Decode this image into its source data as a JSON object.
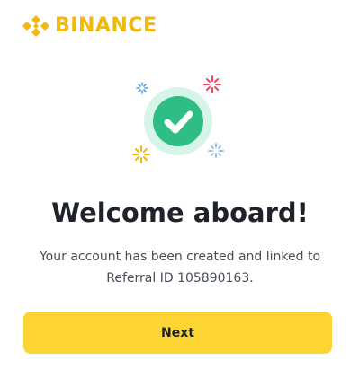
{
  "brand": {
    "name": "BINANCE",
    "logo_icon": "binance-diamond-icon",
    "color": "#F0B90B"
  },
  "illustration": {
    "icon": "check-circle-icon",
    "ring_color": "#D6F5E8",
    "check_color": "#2EBD85",
    "sparkle_colors": [
      "#F6465D",
      "#F0B90B",
      "#5B9BD5"
    ]
  },
  "welcome": {
    "title": "Welcome aboard!",
    "message_line1": "Your account has been created and linked to",
    "message_line2": "Referral ID 105890163."
  },
  "actions": {
    "next_label": "Next",
    "button_color": "#FCD535"
  }
}
